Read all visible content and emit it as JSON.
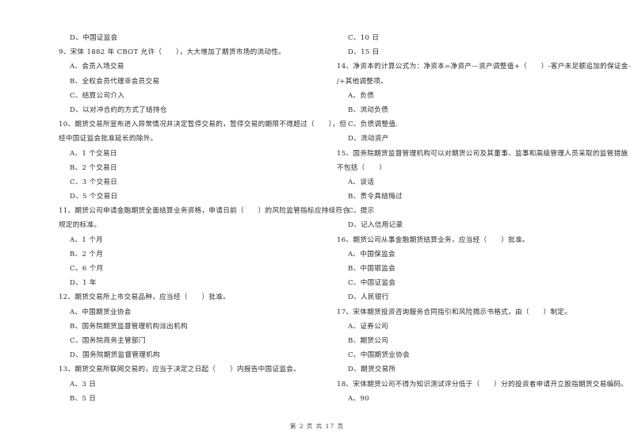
{
  "left_column": [
    {
      "type": "opt",
      "text": "D、中国证监会"
    },
    {
      "type": "q",
      "text": "9、宋体 1882 年 CBOT 允许（　　），大大增加了期货市场的流动性。"
    },
    {
      "type": "opt",
      "text": "A、会员入场交易"
    },
    {
      "type": "opt",
      "text": "B、全权会员代理非会员交易"
    },
    {
      "type": "opt",
      "text": "C、结算公司介入"
    },
    {
      "type": "opt",
      "text": "D、以对冲合约的方式了结持仓"
    },
    {
      "type": "q",
      "text": "10、期货交易所宣布进入异常情况并决定暂停交易的，暂停交易的期限不得超过（　　），但"
    },
    {
      "type": "q-cont",
      "text": "经中国证监会批准延长的除外。"
    },
    {
      "type": "opt",
      "text": "A、1 个交易日"
    },
    {
      "type": "opt",
      "text": "B、2 个交易日"
    },
    {
      "type": "opt",
      "text": "C、3 个交易日"
    },
    {
      "type": "opt",
      "text": "D、5 个交易日"
    },
    {
      "type": "q",
      "text": "11、期货公司申请金融期货全面结算业务资格，申请日前（　　）的风险监管指标应持续符合"
    },
    {
      "type": "q-cont",
      "text": "规定的标准。"
    },
    {
      "type": "opt",
      "text": "A、1 个月"
    },
    {
      "type": "opt",
      "text": "B、2 个月"
    },
    {
      "type": "opt",
      "text": "C、6 个月"
    },
    {
      "type": "opt",
      "text": "D、1 年"
    },
    {
      "type": "q",
      "text": "12、期货交易所上市交易品种，应当经（　　）批准。"
    },
    {
      "type": "opt",
      "text": "A、中国期货业协会"
    },
    {
      "type": "opt",
      "text": "B、国务院期货监督管理机构派出机构"
    },
    {
      "type": "opt",
      "text": "C、国务院商务主管部门"
    },
    {
      "type": "opt",
      "text": "D、国务院期货监督管理机构"
    },
    {
      "type": "q",
      "text": "13、期货交易所联网交易的，应当于决定之日起（　　）内报告中国证监会。"
    },
    {
      "type": "opt",
      "text": "A、3 日"
    },
    {
      "type": "opt",
      "text": "B、5 日"
    }
  ],
  "right_column": [
    {
      "type": "opt",
      "text": "C、10 日"
    },
    {
      "type": "opt",
      "text": "D、15 日"
    },
    {
      "type": "q",
      "text": "14、净资本的计算公式为：净资本=净资产—资产调整值+（　　）-客户未足额追加的保证金-"
    },
    {
      "type": "q-cont",
      "text": "/+其他调整项。"
    },
    {
      "type": "opt",
      "text": "A、负债"
    },
    {
      "type": "opt",
      "text": "B、流动负债"
    },
    {
      "type": "opt",
      "text": "C、负债调整值."
    },
    {
      "type": "opt",
      "text": "D、流动资产"
    },
    {
      "type": "q",
      "text": "15、国务院期货监督管理机构可以对期货公司及其董事、监事和高级管理人员采取的监管措施"
    },
    {
      "type": "q-cont",
      "text": "不包括（　　）"
    },
    {
      "type": "opt",
      "text": "A、谈话"
    },
    {
      "type": "opt",
      "text": "B、责令具结悔过"
    },
    {
      "type": "opt",
      "text": "C、提示"
    },
    {
      "type": "opt",
      "text": "D、记入信用记录"
    },
    {
      "type": "q",
      "text": "16、期货公司从事金融期货结算业务，应当经（　　）批准。"
    },
    {
      "type": "opt",
      "text": "A、中国保监会"
    },
    {
      "type": "opt",
      "text": "B、中国银监会"
    },
    {
      "type": "opt",
      "text": "C、中国证监会"
    },
    {
      "type": "opt",
      "text": "D、人民银行"
    },
    {
      "type": "q",
      "text": "17、宋体期货投资咨询服务合同指引和风险揭示书格式，由（　　）制定。"
    },
    {
      "type": "opt",
      "text": "A、证券公司"
    },
    {
      "type": "opt",
      "text": "B、期货公司"
    },
    {
      "type": "opt",
      "text": "C、中国期货业协会"
    },
    {
      "type": "opt",
      "text": "D、期货交易所"
    },
    {
      "type": "q",
      "text": "18、宋体期货公司不得为知识测试评分低于（　　）分的投资者申请开立股指期货交易编码。"
    },
    {
      "type": "opt",
      "text": "A、90"
    }
  ],
  "footer": {
    "page_label": "第 2 页 共 17 页"
  }
}
